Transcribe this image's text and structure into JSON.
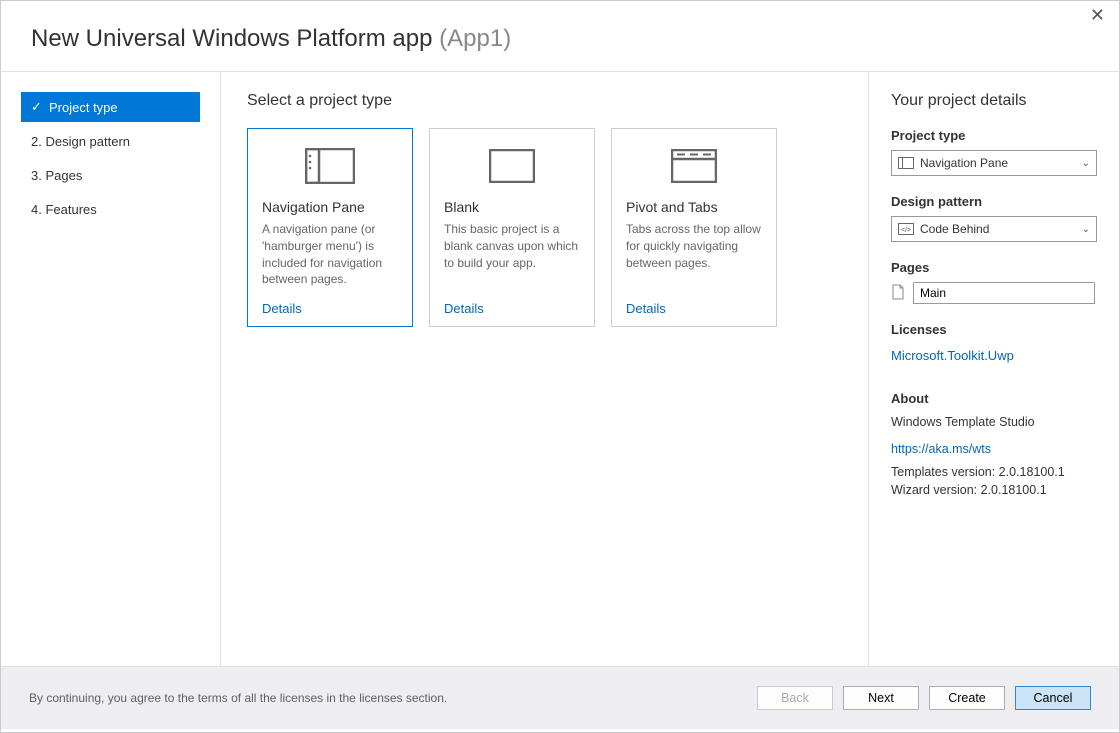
{
  "header": {
    "title": "New Universal Windows Platform app",
    "appname": "(App1)"
  },
  "close_label": "✕",
  "sidebar": {
    "items": [
      {
        "label": "Project type",
        "active": true
      },
      {
        "label": "2.  Design pattern"
      },
      {
        "label": "3.  Pages"
      },
      {
        "label": "4.  Features"
      }
    ]
  },
  "main": {
    "heading": "Select a project type",
    "cards": [
      {
        "title": "Navigation Pane",
        "desc": "A navigation pane (or 'hamburger menu') is included for navigation between pages.",
        "details": "Details"
      },
      {
        "title": "Blank",
        "desc": "This basic project is a blank canvas upon which to build your app.",
        "details": "Details"
      },
      {
        "title": "Pivot and Tabs",
        "desc": "Tabs across the top allow for quickly navigating between pages.",
        "details": "Details"
      }
    ]
  },
  "details": {
    "heading": "Your project details",
    "project_type_label": "Project type",
    "project_type_value": "Navigation Pane",
    "design_pattern_label": "Design pattern",
    "design_pattern_value": "Code Behind",
    "pages_label": "Pages",
    "pages_value": "Main",
    "licenses_label": "Licenses",
    "license_link": "Microsoft.Toolkit.Uwp",
    "about_label": "About",
    "about_name": "Windows Template Studio",
    "about_url": "https://aka.ms/wts",
    "templates_version": "Templates version: 2.0.18100.1",
    "wizard_version": "Wizard version: 2.0.18100.1"
  },
  "footer": {
    "agree": "By continuing, you agree to the terms of all the licenses in the licenses section.",
    "back": "Back",
    "next": "Next",
    "create": "Create",
    "cancel": "Cancel"
  }
}
